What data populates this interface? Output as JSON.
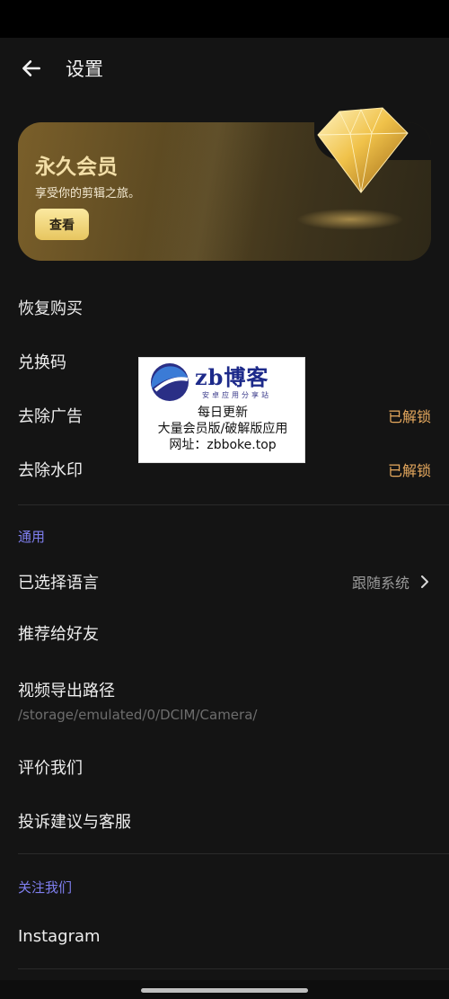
{
  "app_bar": {
    "title": "设置"
  },
  "vip": {
    "title": "永久会员",
    "subtitle": "享受你的剪辑之旅。",
    "button": "查看"
  },
  "purchase": [
    {
      "label": "恢复购买",
      "value": ""
    },
    {
      "label": "兑换码",
      "value": ""
    },
    {
      "label": "去除广告",
      "value": "已解锁"
    },
    {
      "label": "去除水印",
      "value": "已解锁"
    }
  ],
  "general": {
    "header": "通用",
    "language": {
      "label": "已选择语言",
      "value": "跟随系统"
    },
    "recommend": {
      "label": "推荐给好友"
    },
    "export_path": {
      "label": "视频导出路径",
      "value": "/storage/emulated/0/DCIM/Camera/"
    },
    "rate": {
      "label": "评价我们"
    },
    "feedback": {
      "label": "投诉建议与客服"
    }
  },
  "follow": {
    "header": "关注我们",
    "instagram": {
      "label": "Instagram"
    }
  },
  "watermark": {
    "brand": "zb博客",
    "brand_sub": "安卓应用分享站",
    "line1": "每日更新",
    "line2": "大量会员版/破解版应用",
    "line3": "网址：zbboke.top"
  },
  "colors": {
    "accent_orange": "#e6a95e",
    "section_purple": "#7f7fef",
    "gold": "#f3dfa8"
  },
  "icons": {
    "back": "arrow-left-icon",
    "chevron": "chevron-right-icon",
    "diamond": "diamond-icon"
  }
}
